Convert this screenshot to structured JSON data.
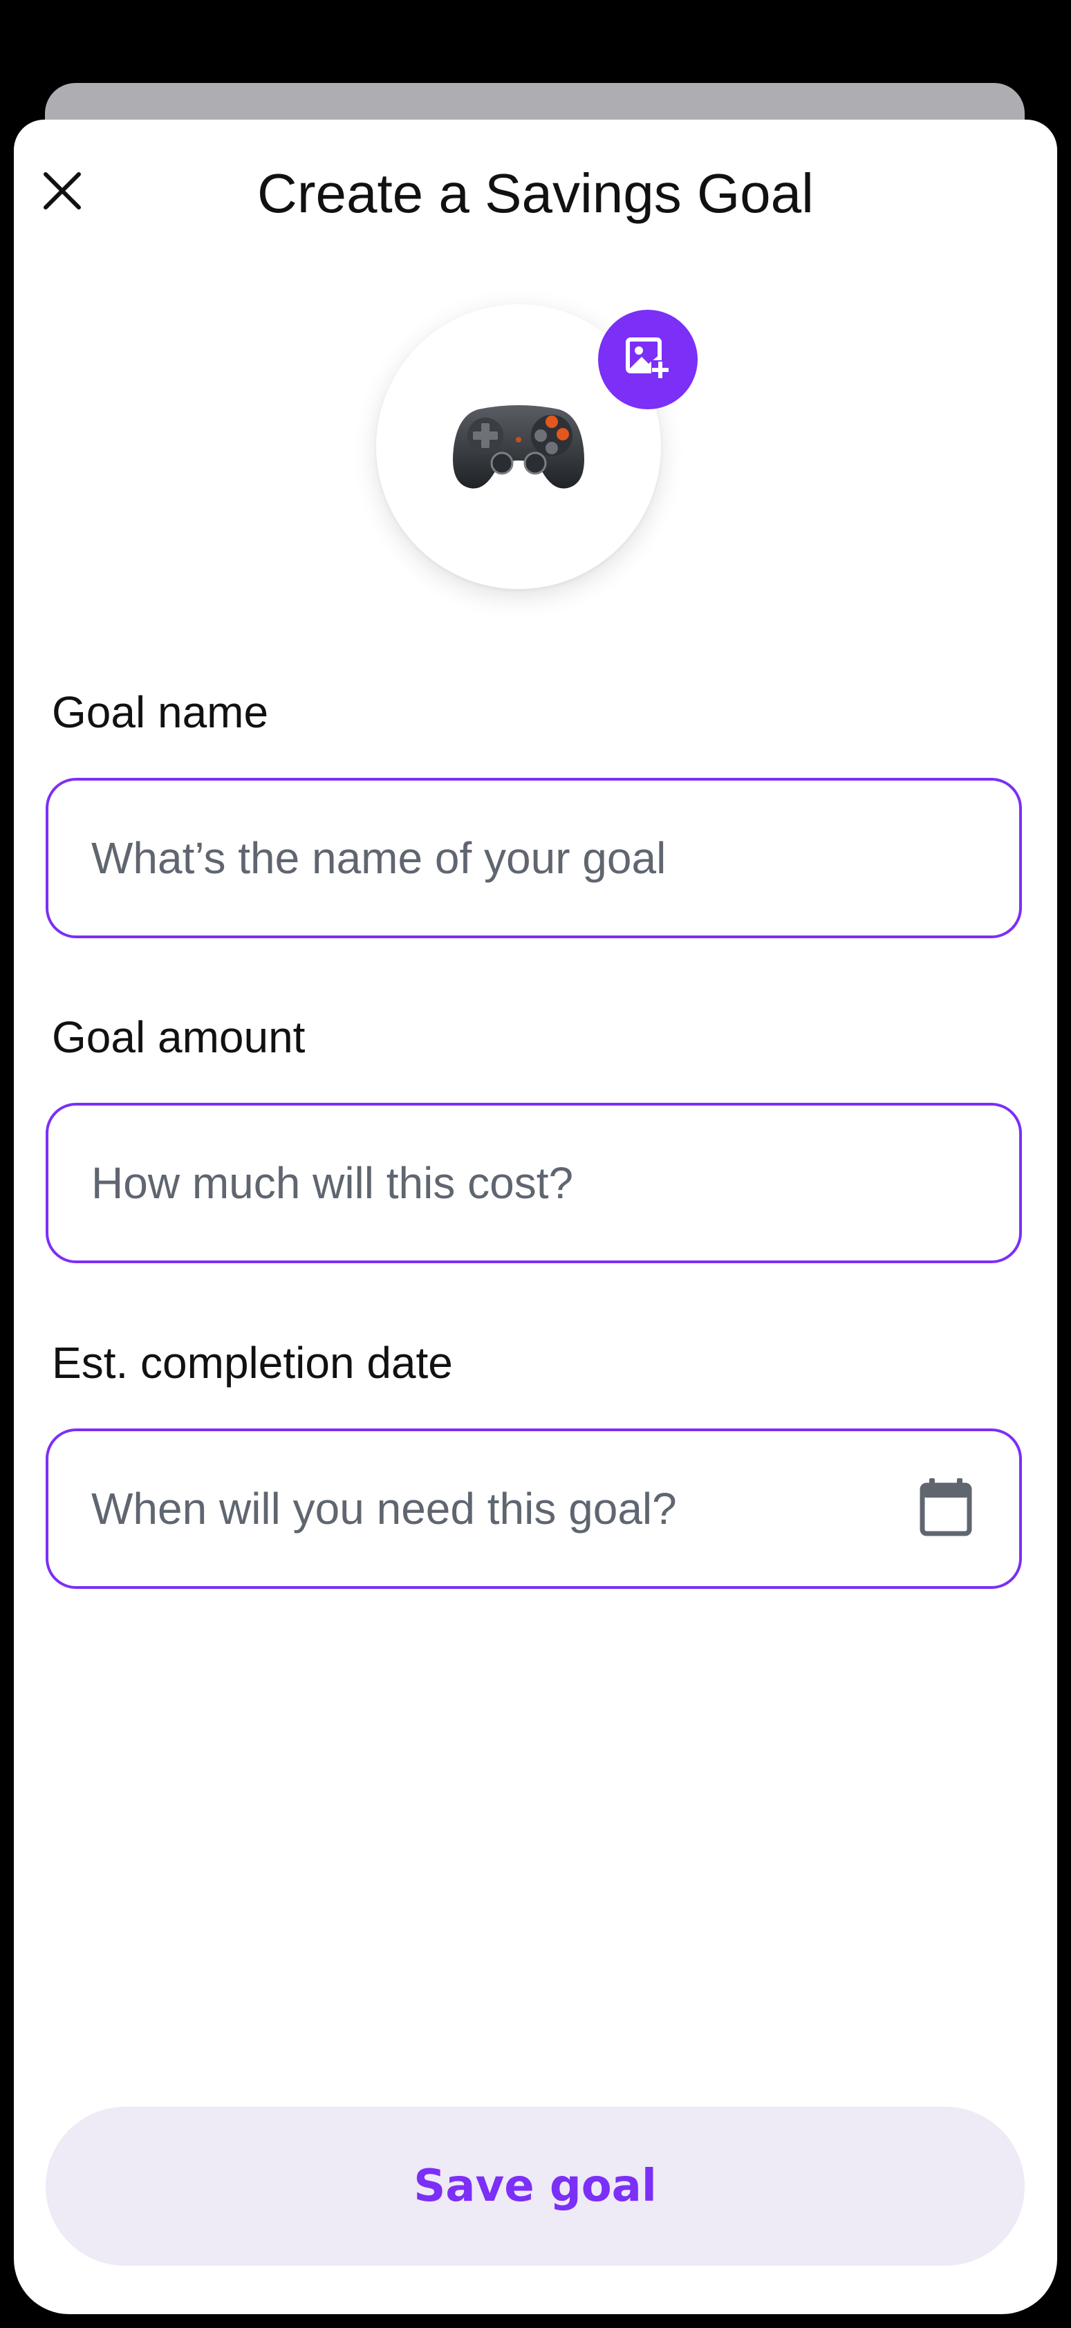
{
  "header": {
    "title": "Create a Savings Goal",
    "close_icon": "close-icon"
  },
  "goal_image": {
    "emoji": "🎮",
    "emoji_name": "video-game-controller",
    "add_image_icon": "image-add-icon"
  },
  "form": {
    "goal_name": {
      "label": "Goal name",
      "value": "",
      "placeholder": "What’s the name of your goal"
    },
    "goal_amount": {
      "label": "Goal amount",
      "value": "",
      "placeholder": "How much will this cost?"
    },
    "completion_date": {
      "label": "Est. completion date",
      "value": "",
      "placeholder": "When will you need this goal?",
      "icon": "calendar-icon"
    }
  },
  "actions": {
    "save_label": "Save goal"
  },
  "colors": {
    "accent": "#7B2FF7",
    "save_button_bg": "#EEEAF6",
    "placeholder": "#5F6670",
    "text": "#111111"
  }
}
